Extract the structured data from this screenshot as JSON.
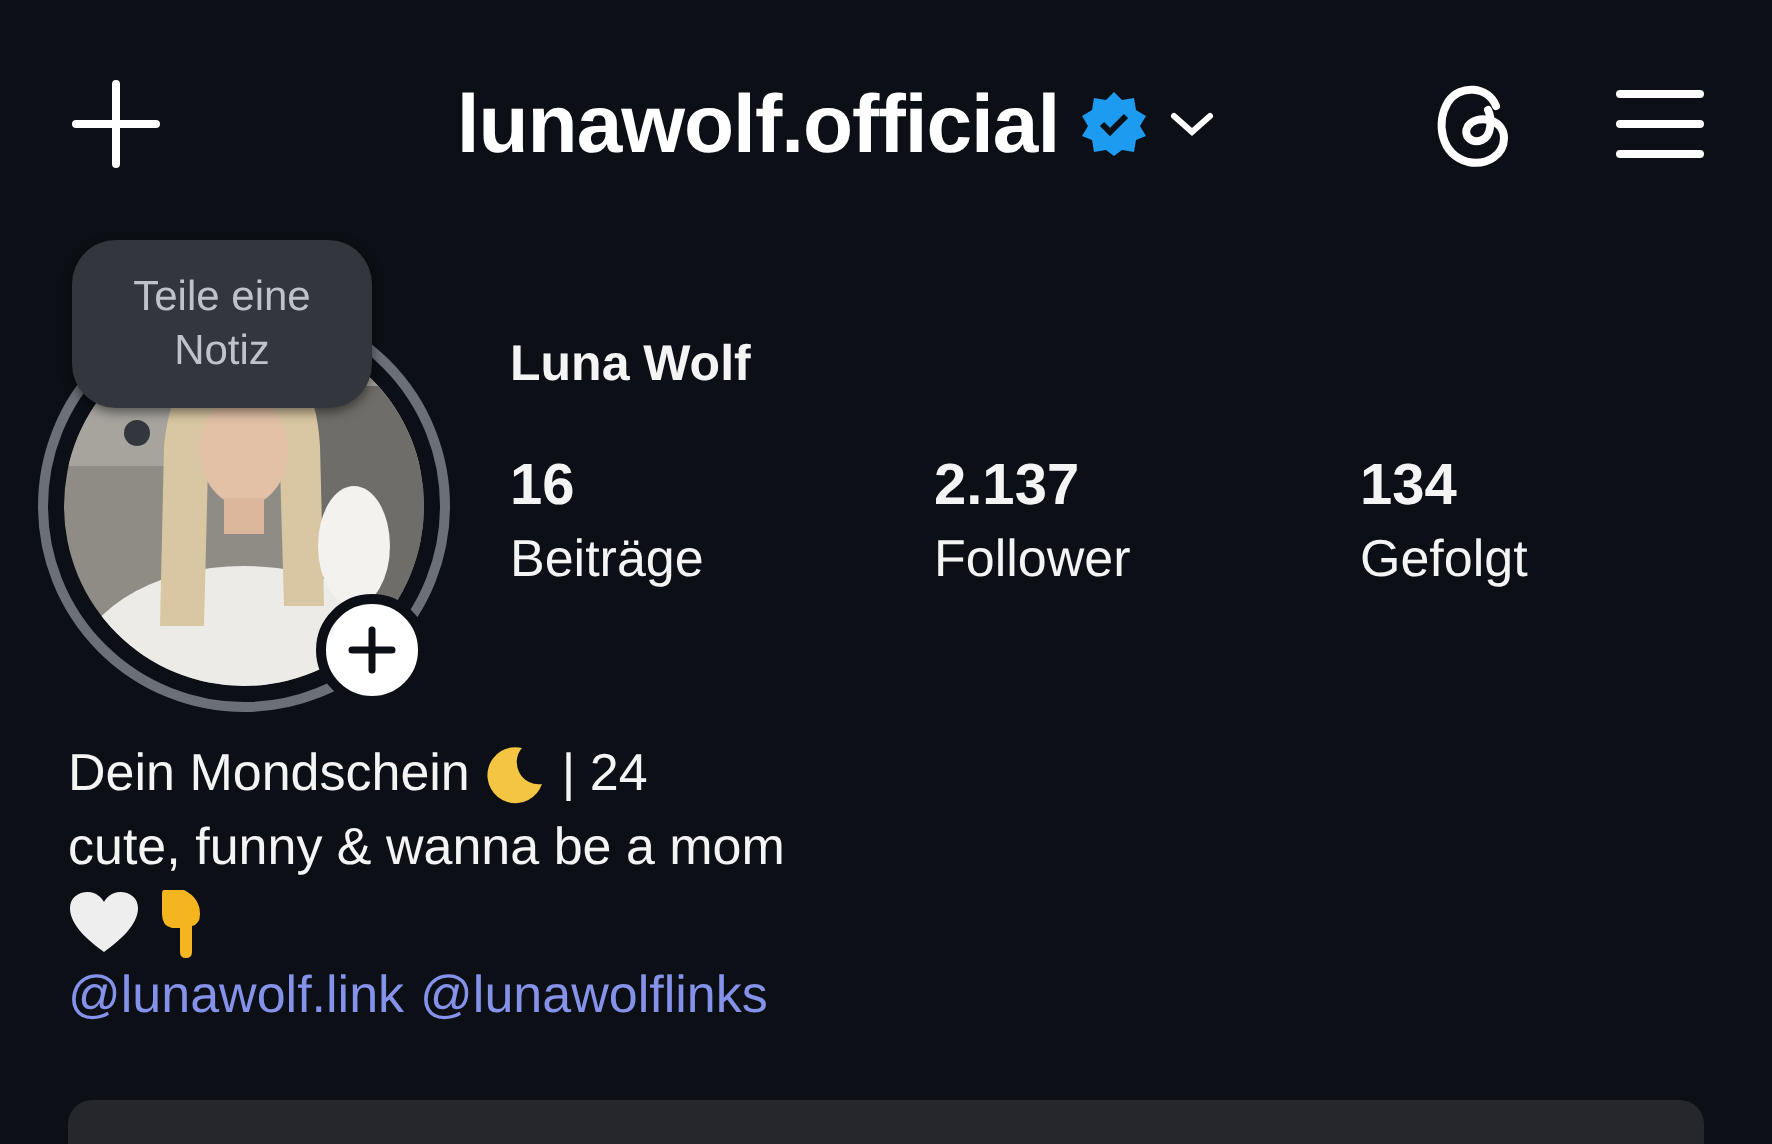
{
  "header": {
    "title": "lunawolf.official",
    "verified": true
  },
  "note": {
    "text": "Teile eine Notiz"
  },
  "profile": {
    "name": "Luna Wolf",
    "stats": [
      {
        "value": "16",
        "label": "Beiträge"
      },
      {
        "value": "2.137",
        "label": "Follower"
      },
      {
        "value": "134",
        "label": "Gefolgt"
      }
    ]
  },
  "bio": [
    [
      {
        "kind": "text",
        "text": "Dein Mondschein"
      },
      {
        "kind": "moon"
      },
      {
        "kind": "text",
        "text": "| 24"
      }
    ],
    [
      {
        "kind": "text",
        "text": "cute, funny & wanna be a mom"
      }
    ],
    [
      {
        "kind": "heart"
      },
      {
        "kind": "pointing-down"
      }
    ]
  ],
  "links": [
    "@lunawolf.link",
    "@lunawolflinks"
  ]
}
